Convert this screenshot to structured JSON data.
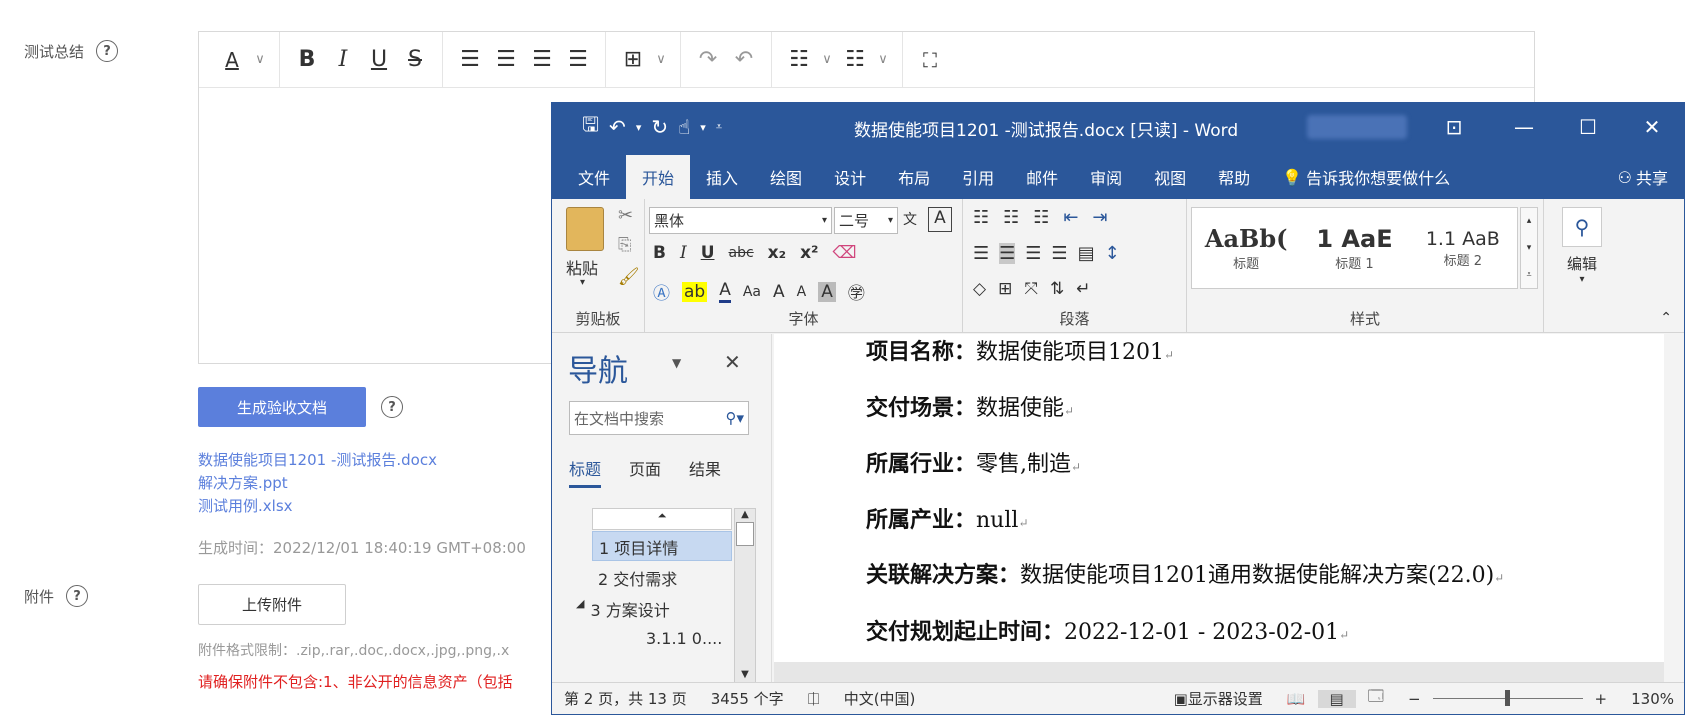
{
  "form": {
    "summary_label": "测试总结",
    "generate_button": "生成验收文档",
    "files": [
      "数据使能项目1201 -测试报告.docx",
      "解决方案.ppt",
      "测试用例.xlsx"
    ],
    "generated_time": "生成时间：2022/12/01 18:40:19 GMT+08:00",
    "attachment_label": "附件",
    "upload_button": "上传附件",
    "format_limit": "附件格式限制：.zip,.rar,.doc,.docx,.jpg,.png,.x",
    "warning": "请确保附件不包含:1、非公开的信息资产（包括"
  },
  "editor_toolbar": {
    "font_color": "A",
    "bold": "B",
    "italic": "I",
    "underline": "U",
    "strike": "S"
  },
  "word": {
    "title": "数据使能项目1201 -测试报告.docx [只读] - Word",
    "tabs": [
      "文件",
      "开始",
      "插入",
      "绘图",
      "设计",
      "布局",
      "引用",
      "邮件",
      "审阅",
      "视图",
      "帮助"
    ],
    "tell_me": "告诉我你想要做什么",
    "share": "共享",
    "clipboard": {
      "paste": "粘贴",
      "group": "剪贴板"
    },
    "font": {
      "name": "黑体",
      "size": "二号",
      "group": "字体",
      "bold": "B",
      "italic": "I",
      "underline": "U",
      "strike": "abc",
      "sub": "x₂",
      "sup": "x²",
      "case": "Aa"
    },
    "paragraph": {
      "group": "段落"
    },
    "styles": {
      "group": "样式",
      "items": [
        {
          "preview": "AaBb(",
          "name": "标题"
        },
        {
          "preview": "1  AaE",
          "name": "标题 1"
        },
        {
          "preview": "1.1  AaB",
          "name": "标题 2"
        }
      ]
    },
    "editing": "编辑",
    "nav": {
      "title": "导航",
      "search_placeholder": "在文档中搜索",
      "tabs": [
        "标题",
        "页面",
        "结果"
      ],
      "items": [
        "1 项目详情",
        "2 交付需求",
        "3 方案设计",
        "3.1.1 0...."
      ]
    },
    "doc_lines": [
      {
        "k": "项目名称：",
        "v": "数据使能项目1201"
      },
      {
        "k": "交付场景：",
        "v": "数据使能"
      },
      {
        "k": "所属行业：",
        "v": "零售,制造"
      },
      {
        "k": "所属产业：",
        "v": "null"
      },
      {
        "k": "关联解决方案：",
        "v": "数据使能项目1201通用数据使能解决方案(22.0)"
      },
      {
        "k": "交付规划起止时间：",
        "v": "2022-12-01 - 2023-02-01"
      }
    ],
    "status": {
      "page": "第 2 页，共 13 页",
      "words": "3455 个字",
      "lang": "中文(中国)",
      "display": "显示器设置",
      "zoom": "130%"
    }
  }
}
